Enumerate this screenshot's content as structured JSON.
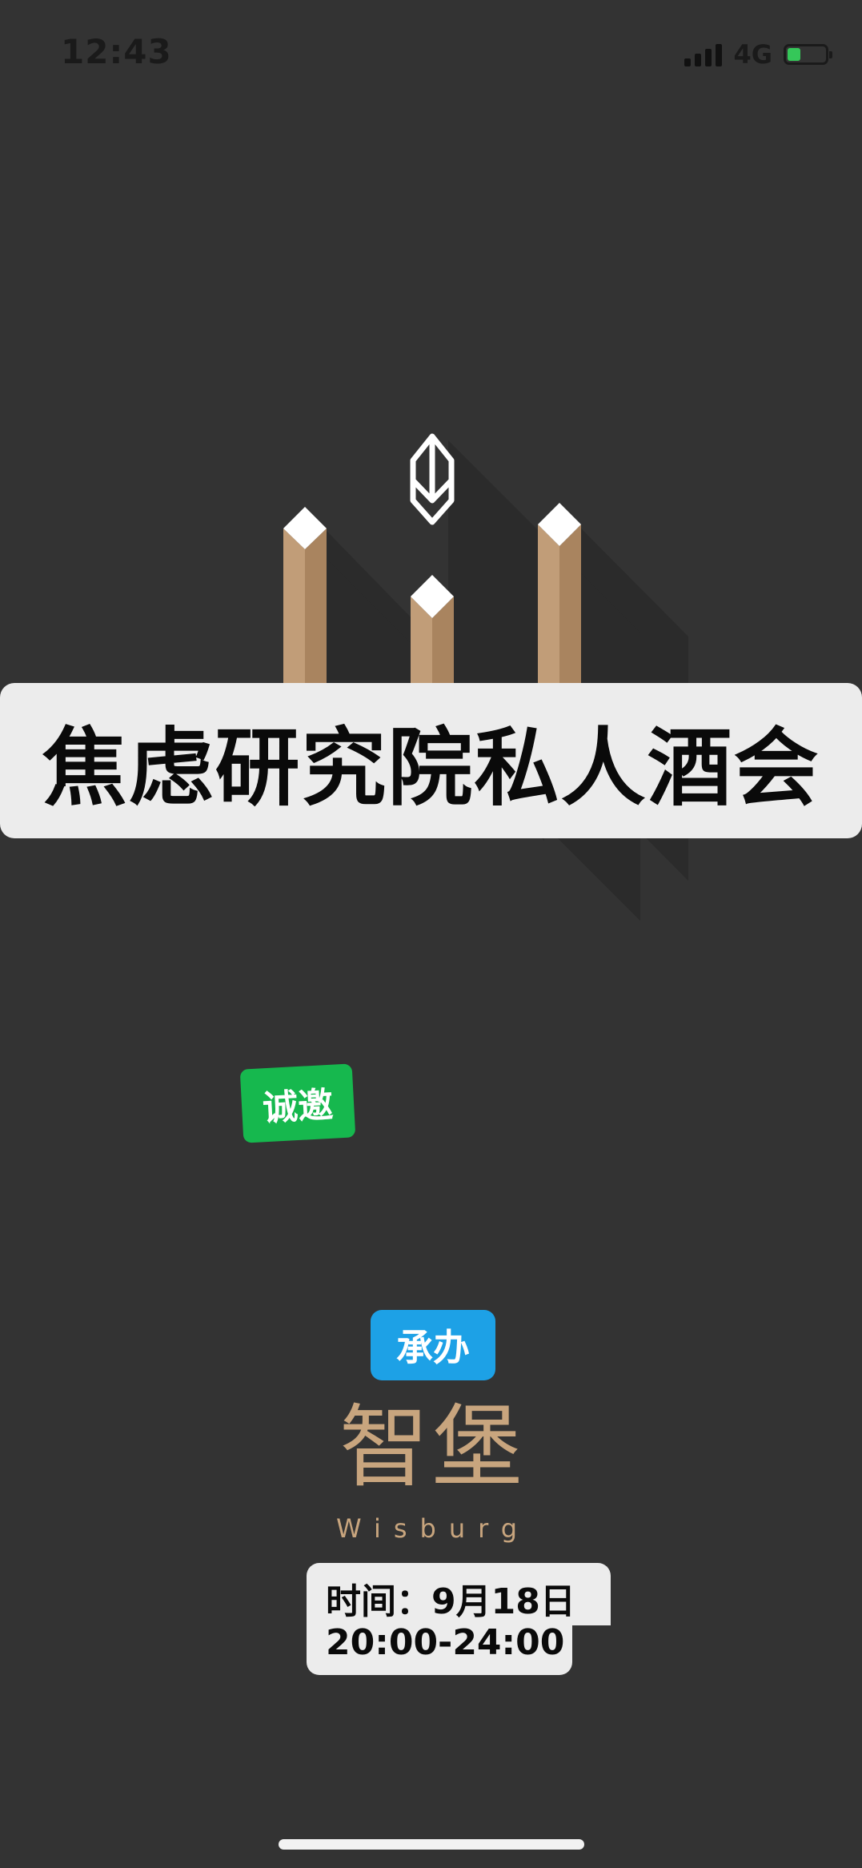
{
  "status_bar": {
    "time": "12:43",
    "network": "4G",
    "battery_level": 0.35,
    "signal_bars": 4
  },
  "poster": {
    "title": "焦虑研究院私人酒会",
    "invite_badge": "诚邀",
    "host_badge": "承办",
    "brand_name_cn": "智堡",
    "brand_name_en": "Wisburg",
    "time_line_1": "时间：9月18日",
    "time_line_2": "20:00-24:00"
  },
  "colors": {
    "background": "#333333",
    "banner": "#ececec",
    "invite_green": "#16b84e",
    "host_blue": "#1da1e6",
    "brand_gold": "#c8a57e"
  }
}
